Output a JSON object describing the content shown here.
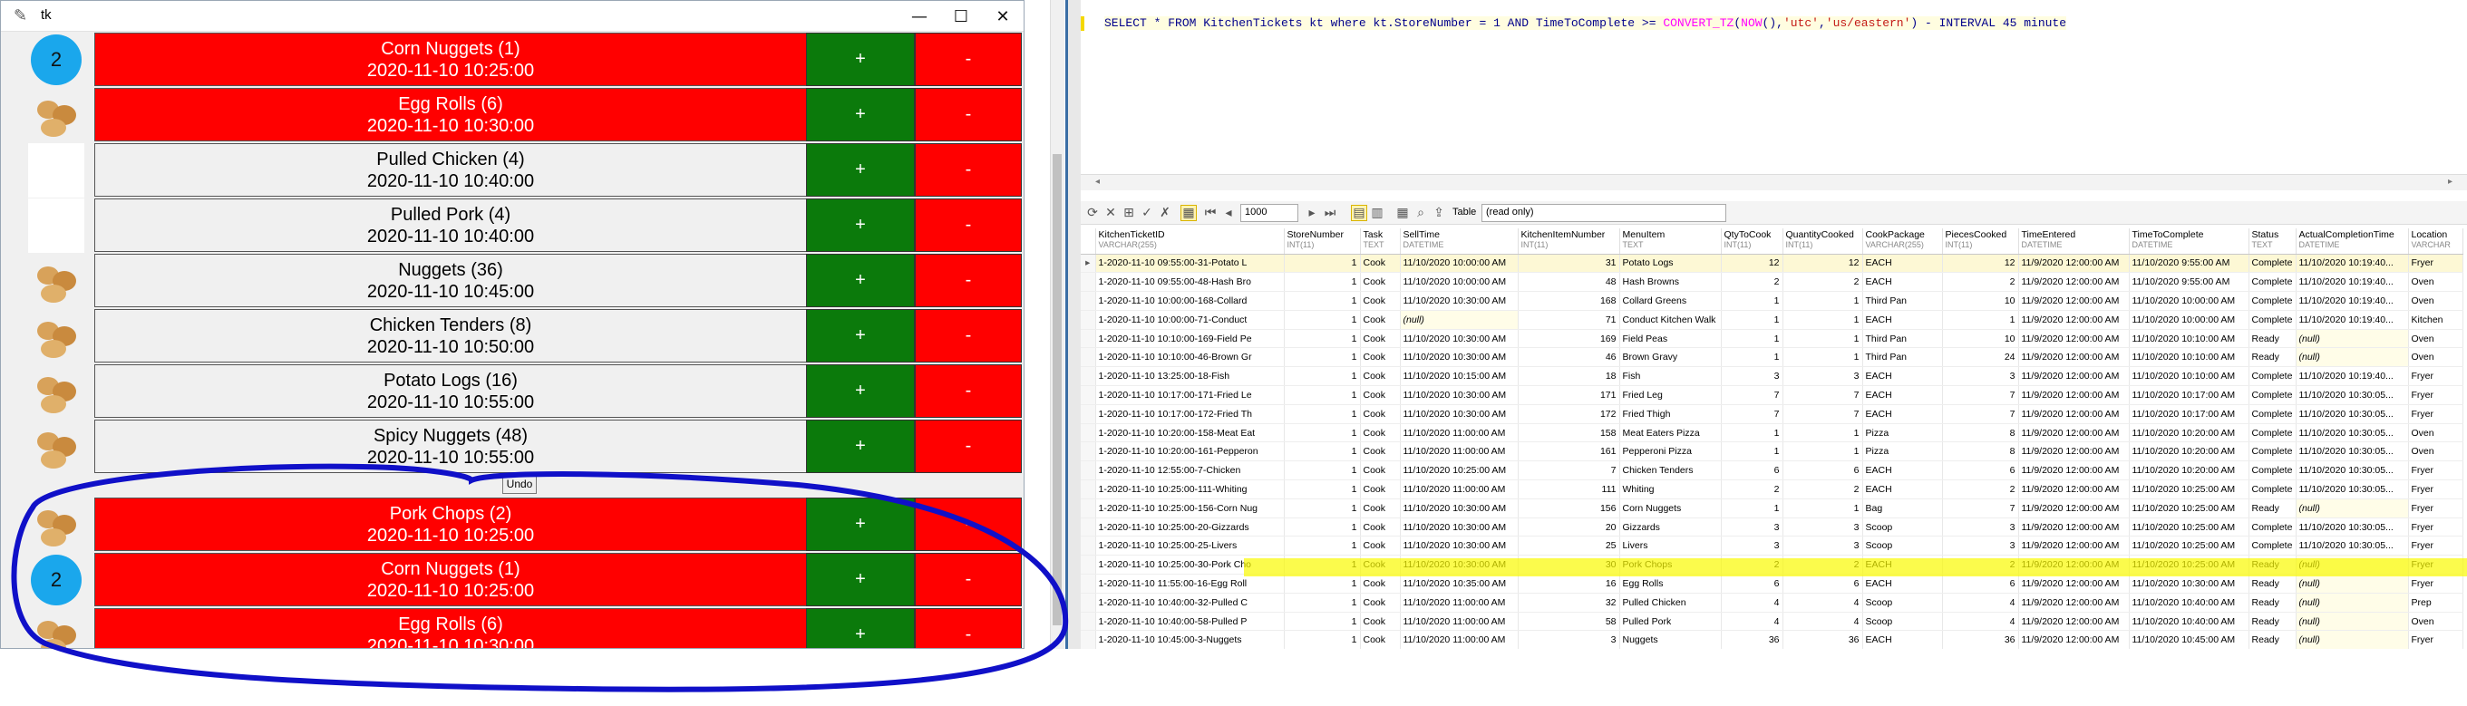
{
  "tk_window": {
    "title": "tk",
    "tickets": [
      {
        "label": "Corn Nuggets (1)",
        "time": "2020-11-10 10:25:00",
        "color": "#ff0000",
        "thumb": "badge",
        "badge": "2"
      },
      {
        "label": "Egg Rolls (6)",
        "time": "2020-11-10 10:30:00",
        "color": "#ff0000",
        "thumb": "egg-roll-image"
      },
      {
        "label": "Pulled Chicken (4)",
        "time": "2020-11-10 10:40:00",
        "color": "#f0f0f0",
        "thumb": "blank"
      },
      {
        "label": "Pulled Pork (4)",
        "time": "2020-11-10 10:40:00",
        "color": "#f0f0f0",
        "thumb": "blank"
      },
      {
        "label": "Nuggets (36)",
        "time": "2020-11-10 10:45:00",
        "color": "#f0f0f0",
        "thumb": "nuggets-image"
      },
      {
        "label": "Chicken Tenders (8)",
        "time": "2020-11-10 10:50:00",
        "color": "#f0f0f0",
        "thumb": "tenders-image"
      },
      {
        "label": "Potato Logs (16)",
        "time": "2020-11-10 10:55:00",
        "color": "#f0f0f0",
        "thumb": "potato-logs-image"
      },
      {
        "label": "Spicy Nuggets (48)",
        "time": "2020-11-10 10:55:00",
        "color": "#f0f0f0",
        "thumb": "nuggets-image"
      }
    ],
    "undo_label": "Undo",
    "tickets_lower": [
      {
        "label": "Pork Chops (2)",
        "time": "2020-11-10 10:25:00",
        "color": "#ff0000",
        "thumb": "pork-chop-image"
      },
      {
        "label": "Corn Nuggets (1)",
        "time": "2020-11-10 10:25:00",
        "color": "#ff0000",
        "thumb": "badge",
        "badge": "2"
      },
      {
        "label": "Egg Rolls (6)",
        "time": "2020-11-10 10:30:00",
        "color": "#ff0000",
        "thumb": "egg-roll-image"
      }
    ],
    "plus_label": "+",
    "minus_label": "-"
  },
  "sql_editor": {
    "query_parts": [
      "SELECT * FROM KitchenTickets kt where kt.StoreNumber = 1 AND TimeToComplete >= ",
      "CONVERT_TZ",
      "(",
      "NOW",
      "(),",
      "'utc'",
      ",",
      "'us/eastern'",
      ") - INTERVAL 45 minute"
    ]
  },
  "results_toolbar": {
    "limit_value": "1000",
    "view_label": "Table",
    "mode_value": "(read only)"
  },
  "results_grid": {
    "columns": [
      {
        "name": "KitchenTicketID",
        "type": "VARCHAR(255)"
      },
      {
        "name": "StoreNumber",
        "type": "INT(11)"
      },
      {
        "name": "Task",
        "type": "TEXT"
      },
      {
        "name": "SellTime",
        "type": "DATETIME"
      },
      {
        "name": "KitchenItemNumber",
        "type": "INT(11)"
      },
      {
        "name": "MenuItem",
        "type": "TEXT"
      },
      {
        "name": "QtyToCook",
        "type": "INT(11)"
      },
      {
        "name": "QuantityCooked",
        "type": "INT(11)"
      },
      {
        "name": "CookPackage",
        "type": "VARCHAR(255)"
      },
      {
        "name": "PiecesCooked",
        "type": "INT(11)"
      },
      {
        "name": "TimeEntered",
        "type": "DATETIME"
      },
      {
        "name": "TimeToComplete",
        "type": "DATETIME"
      },
      {
        "name": "Status",
        "type": "TEXT"
      },
      {
        "name": "ActualCompletionTime",
        "type": "DATETIME"
      },
      {
        "name": "Location",
        "type": "VARCHAR"
      }
    ],
    "rows": [
      [
        "1-2020-11-10 09:55:00-31-Potato L",
        "1",
        "Cook",
        "11/10/2020 10:00:00 AM",
        "31",
        "Potato Logs",
        "12",
        "12",
        "EACH",
        "12",
        "11/9/2020 12:00:00 AM",
        "11/10/2020 9:55:00 AM",
        "Complete",
        "11/10/2020 10:19:40...",
        "Fryer"
      ],
      [
        "1-2020-11-10 09:55:00-48-Hash Bro",
        "1",
        "Cook",
        "11/10/2020 10:00:00 AM",
        "48",
        "Hash Browns",
        "2",
        "2",
        "EACH",
        "2",
        "11/9/2020 12:00:00 AM",
        "11/10/2020 9:55:00 AM",
        "Complete",
        "11/10/2020 10:19:40...",
        "Oven"
      ],
      [
        "1-2020-11-10 10:00:00-168-Collard",
        "1",
        "Cook",
        "11/10/2020 10:30:00 AM",
        "168",
        "Collard Greens",
        "1",
        "1",
        "Third Pan",
        "10",
        "11/9/2020 12:00:00 AM",
        "11/10/2020 10:00:00 AM",
        "Complete",
        "11/10/2020 10:19:40...",
        "Oven"
      ],
      [
        "1-2020-11-10 10:00:00-71-Conduct",
        "1",
        "Cook",
        "(null)",
        "71",
        "Conduct Kitchen Walk",
        "1",
        "1",
        "EACH",
        "1",
        "11/9/2020 12:00:00 AM",
        "11/10/2020 10:00:00 AM",
        "Complete",
        "11/10/2020 10:19:40...",
        "Kitchen"
      ],
      [
        "1-2020-11-10 10:10:00-169-Field Pe",
        "1",
        "Cook",
        "11/10/2020 10:30:00 AM",
        "169",
        "Field Peas",
        "1",
        "1",
        "Third Pan",
        "10",
        "11/9/2020 12:00:00 AM",
        "11/10/2020 10:10:00 AM",
        "Ready",
        "(null)",
        "Oven"
      ],
      [
        "1-2020-11-10 10:10:00-46-Brown Gr",
        "1",
        "Cook",
        "11/10/2020 10:30:00 AM",
        "46",
        "Brown Gravy",
        "1",
        "1",
        "Third Pan",
        "24",
        "11/9/2020 12:00:00 AM",
        "11/10/2020 10:10:00 AM",
        "Ready",
        "(null)",
        "Oven"
      ],
      [
        "1-2020-11-10 13:25:00-18-Fish",
        "1",
        "Cook",
        "11/10/2020 10:15:00 AM",
        "18",
        "Fish",
        "3",
        "3",
        "EACH",
        "3",
        "11/9/2020 12:00:00 AM",
        "11/10/2020 10:10:00 AM",
        "Complete",
        "11/10/2020 10:19:40...",
        "Fryer"
      ],
      [
        "1-2020-11-10 10:17:00-171-Fried Le",
        "1",
        "Cook",
        "11/10/2020 10:30:00 AM",
        "171",
        "Fried Leg",
        "7",
        "7",
        "EACH",
        "7",
        "11/9/2020 12:00:00 AM",
        "11/10/2020 10:17:00 AM",
        "Complete",
        "11/10/2020 10:30:05...",
        "Fryer"
      ],
      [
        "1-2020-11-10 10:17:00-172-Fried Th",
        "1",
        "Cook",
        "11/10/2020 10:30:00 AM",
        "172",
        "Fried Thigh",
        "7",
        "7",
        "EACH",
        "7",
        "11/9/2020 12:00:00 AM",
        "11/10/2020 10:17:00 AM",
        "Complete",
        "11/10/2020 10:30:05...",
        "Fryer"
      ],
      [
        "1-2020-11-10 10:20:00-158-Meat Eat",
        "1",
        "Cook",
        "11/10/2020 11:00:00 AM",
        "158",
        "Meat Eaters Pizza",
        "1",
        "1",
        "Pizza",
        "8",
        "11/9/2020 12:00:00 AM",
        "11/10/2020 10:20:00 AM",
        "Complete",
        "11/10/2020 10:30:05...",
        "Oven"
      ],
      [
        "1-2020-11-10 10:20:00-161-Pepperon",
        "1",
        "Cook",
        "11/10/2020 11:00:00 AM",
        "161",
        "Pepperoni Pizza",
        "1",
        "1",
        "Pizza",
        "8",
        "11/9/2020 12:00:00 AM",
        "11/10/2020 10:20:00 AM",
        "Complete",
        "11/10/2020 10:30:05...",
        "Oven"
      ],
      [
        "1-2020-11-10 12:55:00-7-Chicken",
        "1",
        "Cook",
        "11/10/2020 10:25:00 AM",
        "7",
        "Chicken Tenders",
        "6",
        "6",
        "EACH",
        "6",
        "11/9/2020 12:00:00 AM",
        "11/10/2020 10:20:00 AM",
        "Complete",
        "11/10/2020 10:30:05...",
        "Fryer"
      ],
      [
        "1-2020-11-10 10:25:00-111-Whiting",
        "1",
        "Cook",
        "11/10/2020 11:00:00 AM",
        "111",
        "Whiting",
        "2",
        "2",
        "EACH",
        "2",
        "11/9/2020 12:00:00 AM",
        "11/10/2020 10:25:00 AM",
        "Complete",
        "11/10/2020 10:30:05...",
        "Fryer"
      ],
      [
        "1-2020-11-10 10:25:00-156-Corn Nug",
        "1",
        "Cook",
        "11/10/2020 10:30:00 AM",
        "156",
        "Corn Nuggets",
        "1",
        "1",
        "Bag",
        "7",
        "11/9/2020 12:00:00 AM",
        "11/10/2020 10:25:00 AM",
        "Ready",
        "(null)",
        "Fryer"
      ],
      [
        "1-2020-11-10 10:25:00-20-Gizzards",
        "1",
        "Cook",
        "11/10/2020 10:30:00 AM",
        "20",
        "Gizzards",
        "3",
        "3",
        "Scoop",
        "3",
        "11/9/2020 12:00:00 AM",
        "11/10/2020 10:25:00 AM",
        "Complete",
        "11/10/2020 10:30:05...",
        "Fryer"
      ],
      [
        "1-2020-11-10 10:25:00-25-Livers",
        "1",
        "Cook",
        "11/10/2020 10:30:00 AM",
        "25",
        "Livers",
        "3",
        "3",
        "Scoop",
        "3",
        "11/9/2020 12:00:00 AM",
        "11/10/2020 10:25:00 AM",
        "Complete",
        "11/10/2020 10:30:05...",
        "Fryer"
      ],
      [
        "1-2020-11-10 10:25:00-30-Pork Cho",
        "1",
        "Cook",
        "11/10/2020 10:30:00 AM",
        "30",
        "Pork Chops",
        "2",
        "2",
        "EACH",
        "2",
        "11/9/2020 12:00:00 AM",
        "11/10/2020 10:25:00 AM",
        "Ready",
        "(null)",
        "Fryer"
      ],
      [
        "1-2020-11-10 11:55:00-16-Egg Roll",
        "1",
        "Cook",
        "11/10/2020 10:35:00 AM",
        "16",
        "Egg Rolls",
        "6",
        "6",
        "EACH",
        "6",
        "11/9/2020 12:00:00 AM",
        "11/10/2020 10:30:00 AM",
        "Ready",
        "(null)",
        "Fryer"
      ],
      [
        "1-2020-11-10 10:40:00-32-Pulled C",
        "1",
        "Cook",
        "11/10/2020 11:00:00 AM",
        "32",
        "Pulled Chicken",
        "4",
        "4",
        "Scoop",
        "4",
        "11/9/2020 12:00:00 AM",
        "11/10/2020 10:40:00 AM",
        "Ready",
        "(null)",
        "Prep"
      ],
      [
        "1-2020-11-10 10:40:00-58-Pulled P",
        "1",
        "Cook",
        "11/10/2020 11:00:00 AM",
        "58",
        "Pulled Pork",
        "4",
        "4",
        "Scoop",
        "4",
        "11/9/2020 12:00:00 AM",
        "11/10/2020 10:40:00 AM",
        "Ready",
        "(null)",
        "Oven"
      ],
      [
        "1-2020-11-10 10:45:00-3-Nuggets",
        "1",
        "Cook",
        "11/10/2020 11:00:00 AM",
        "3",
        "Nuggets",
        "36",
        "36",
        "EACH",
        "36",
        "11/9/2020 12:00:00 AM",
        "11/10/2020 10:45:00 AM",
        "Ready",
        "(null)",
        "Fryer"
      ]
    ],
    "highlight_row_index": 16
  },
  "annotation": {
    "circle_color": "#1010c8",
    "highlight_color": "#f5f500"
  }
}
